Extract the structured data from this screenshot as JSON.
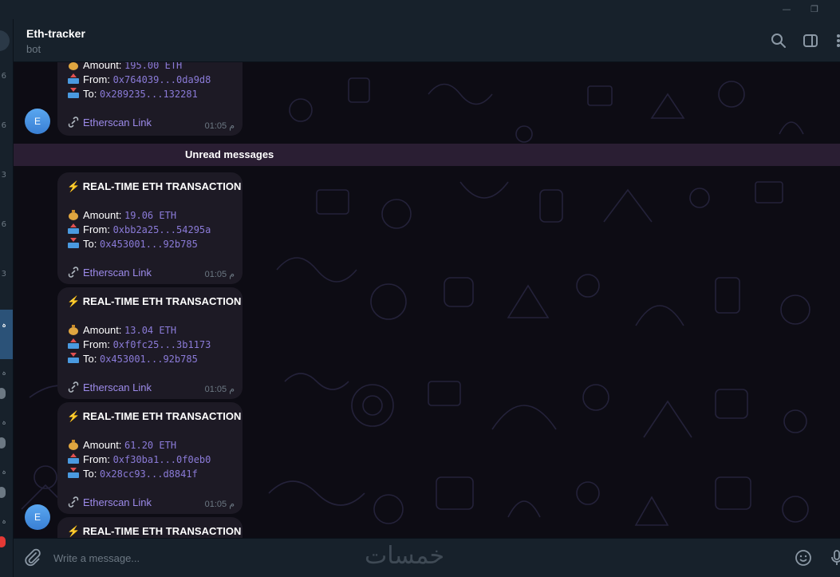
{
  "window": {
    "controls": [
      "—",
      "❐"
    ]
  },
  "left_strip": {
    "numbers": [
      "6",
      "6",
      "3",
      "6",
      "3"
    ],
    "active_glyph": "ہ",
    "lower_glyphs": [
      "ہ",
      "ہ",
      "ہ",
      "ہ"
    ]
  },
  "header": {
    "title": "Eth-tracker",
    "subtitle": "bot",
    "icons": [
      "search-icon",
      "sidebar-icon",
      "more-icon"
    ]
  },
  "unread_label": "Unread messages",
  "messages": [
    {
      "amount": "195.00 ETH",
      "from": "0x764039...0da9d8",
      "to": "0x289235...132281",
      "link": "Etherscan Link",
      "time": "01:05 م"
    },
    {
      "title": "⚡ REAL-TIME ETH TRANSACTION",
      "amount": "19.06 ETH",
      "from": "0xbb2a25...54295a",
      "to": "0x453001...92b785",
      "link": "Etherscan Link",
      "time": "01:05 م"
    },
    {
      "title": "⚡ REAL-TIME ETH TRANSACTION",
      "amount": "13.04 ETH",
      "from": "0xf0fc25...3b1173",
      "to": "0x453001...92b785",
      "link": "Etherscan Link",
      "time": "01:05 م"
    },
    {
      "title": "⚡ REAL-TIME ETH TRANSACTION",
      "amount": "61.20 ETH",
      "from": "0xf30ba1...0f0eb0",
      "to": "0x28cc93...d8841f",
      "link": "Etherscan Link",
      "time": "01:05 م"
    },
    {
      "title": "⚡ REAL-TIME ETH TRANSACTION"
    }
  ],
  "labels": {
    "amount": "Amount: ",
    "from": "From: ",
    "to": "To: "
  },
  "avatar_letter": "E",
  "input": {
    "placeholder": "Write a message..."
  },
  "watermark": "خمسات",
  "colors": {
    "accent": "#9d8bea",
    "header_bg": "#17212b",
    "bubble_bg": "#1d1a25",
    "avatar": "#4a8fe0"
  }
}
